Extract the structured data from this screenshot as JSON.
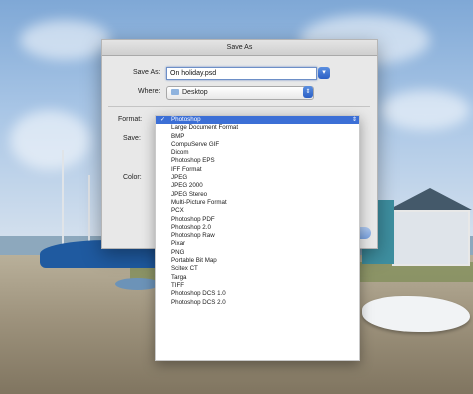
{
  "dialog": {
    "title": "Save As",
    "save_as_label": "Save As:",
    "save_as_value": "On holiday.psd",
    "where_label": "Where:",
    "where_value": "Desktop",
    "format_label": "Format:",
    "save_label": "Save:",
    "color_label": "Color:"
  },
  "format_menu": {
    "selected_check": "✓",
    "items": [
      "Photoshop",
      "Large Document Format",
      "BMP",
      "CompuServe GIF",
      "Dicom",
      "Photoshop EPS",
      "IFF Format",
      "JPEG",
      "JPEG 2000",
      "JPEG Stereo",
      "Multi-Picture Format",
      "PCX",
      "Photoshop PDF",
      "Photoshop 2.0",
      "Photoshop Raw",
      "Pixar",
      "PNG",
      "Portable Bit Map",
      "Scitex CT",
      "Targa",
      "TIFF",
      "Photoshop DCS 1.0",
      "Photoshop DCS 2.0"
    ]
  },
  "colors": {
    "accent": "#3c6fd6",
    "dialog_bg": "#e8e8e8"
  }
}
